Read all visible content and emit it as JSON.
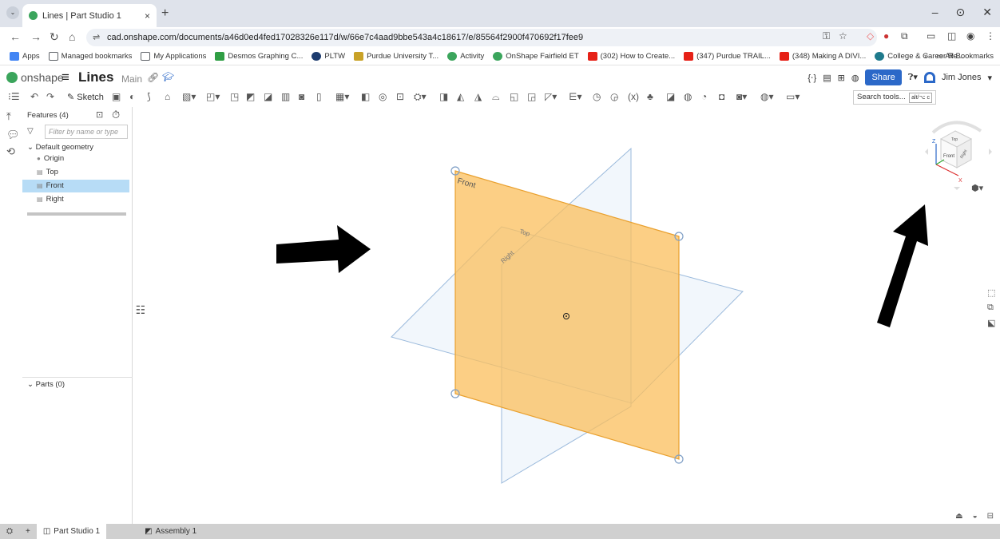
{
  "browser": {
    "tab_title": "Lines | Part Studio 1",
    "tab_close": "×",
    "new_tab": "+",
    "tab_menu": "⌄",
    "window_controls": [
      "–",
      "⊙",
      "✕"
    ],
    "url": "cad.onshape.com/documents/a46d0ed4fed17028326e117d/w/66e7c4aad9bbe543a4c18617/e/85564f2900f470692f17fee9",
    "bookmarks": [
      {
        "label": "Apps",
        "color": "#4285f4"
      },
      {
        "label": "Managed bookmarks",
        "color": "#5f6368"
      },
      {
        "label": "My Applications",
        "color": "#5f6368"
      },
      {
        "label": "Desmos Graphing C...",
        "color": "#2f9e44"
      },
      {
        "label": "PLTW",
        "color": "#1d3b6e"
      },
      {
        "label": "Purdue University T...",
        "color": "#c9a227"
      },
      {
        "label": "Activity",
        "color": "#3ba55c"
      },
      {
        "label": "OnShape Fairfield ET",
        "color": "#3ba55c"
      },
      {
        "label": "(302) How to Create...",
        "color": "#e62117"
      },
      {
        "label": "(347) Purdue TRAIL...",
        "color": "#e62117"
      },
      {
        "label": "(348) Making A DIVI...",
        "color": "#e62117"
      },
      {
        "label": "College & Career Re...",
        "color": "#1f7a8c"
      }
    ],
    "bookmarks_overflow": "»",
    "all_bookmarks": "All Bookmarks"
  },
  "onshape": {
    "logo": "onshape",
    "doc_name": "Lines",
    "branch": "Main",
    "share": "Share",
    "user": "Jim Jones",
    "sketch": "Sketch",
    "search_tools": "Search tools...",
    "search_kbd": "alt/⌥ c",
    "accent": "#2b68c8"
  },
  "features": {
    "title": "Features (4)",
    "filter_placeholder": "Filter by name or type",
    "group": "Default geometry",
    "items": [
      {
        "label": "Origin",
        "selected": false
      },
      {
        "label": "Top",
        "selected": false
      },
      {
        "label": "Front",
        "selected": true
      },
      {
        "label": "Right",
        "selected": false
      }
    ],
    "parts": "Parts (0)"
  },
  "viewport": {
    "front_label": "Front",
    "top_label": "Top",
    "right_label": "Right",
    "plane_color": "#fbbf5c",
    "cube_top": "Top",
    "cube_front": "Front",
    "cube_right": "Right",
    "axis_z": "Z",
    "axis_x": "X"
  },
  "tabs": {
    "part_studio": "Part Studio 1",
    "assembly": "Assembly 1"
  }
}
